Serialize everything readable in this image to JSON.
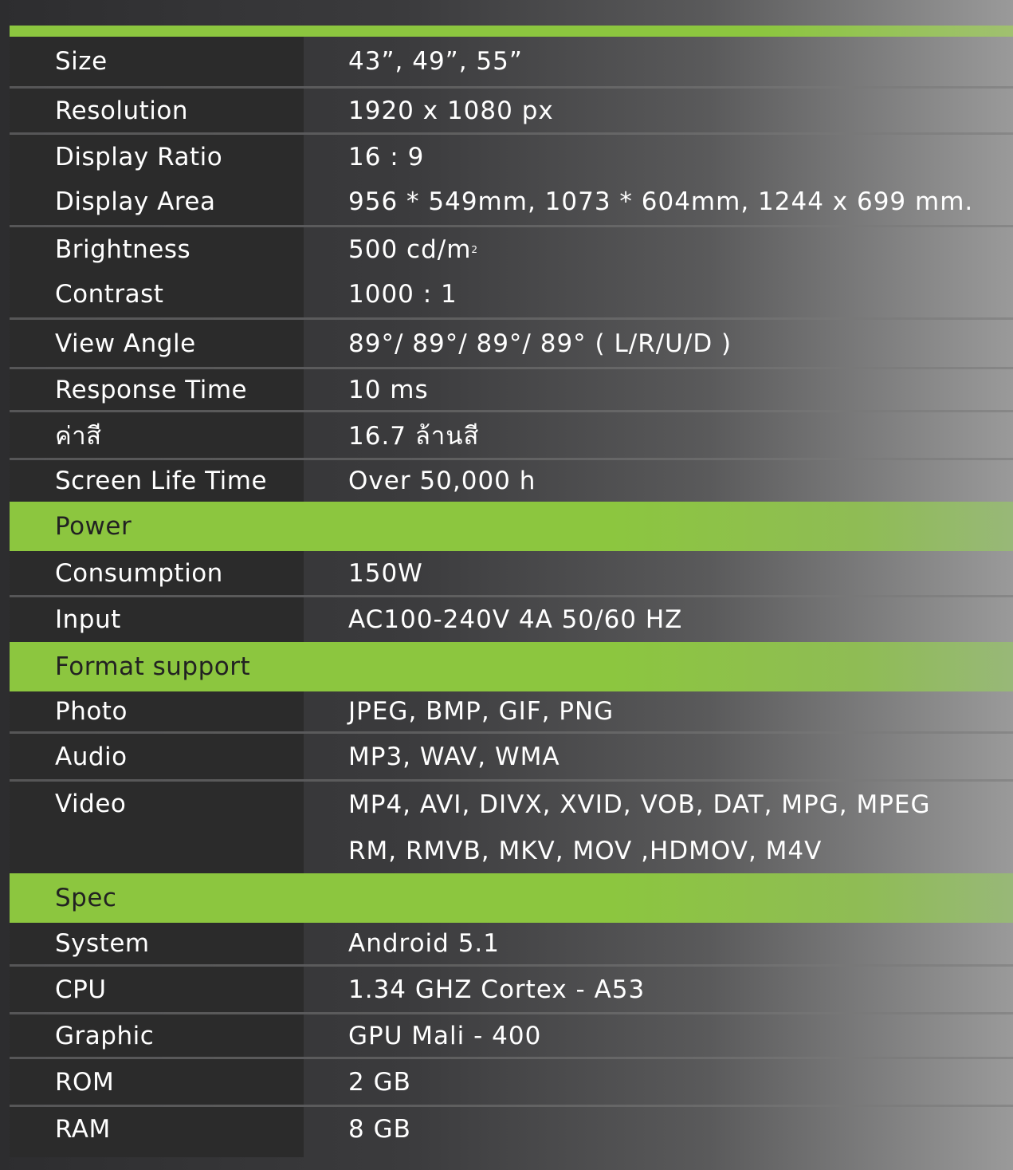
{
  "display": {
    "rows": [
      {
        "label": "Size",
        "value": "43”, 49”, 55”"
      },
      {
        "label": "Resolution",
        "value": "1920 x 1080 px"
      },
      {
        "label": "Display Ratio",
        "value": "16 : 9"
      },
      {
        "label": "Display Area",
        "value": "956 * 549mm, 1073 * 604mm, 1244 x 699 mm."
      },
      {
        "label": "Brightness",
        "value": "500 cd/m",
        "value_sup": "2"
      },
      {
        "label": "Contrast",
        "value": "1000 : 1"
      },
      {
        "label": "View Angle",
        "value": "89°/ 89°/ 89°/ 89° ( L/R/U/D )"
      },
      {
        "label": "Response Time",
        "value": "10 ms"
      },
      {
        "label": "ค่าสี",
        "value": "16.7 ล้านสี"
      },
      {
        "label": "Screen Life Time",
        "value": "Over 50,000 h"
      }
    ]
  },
  "power": {
    "title": "Power",
    "rows": [
      {
        "label": "Consumption",
        "value": "150W"
      },
      {
        "label": "Input",
        "value": "AC100-240V 4A 50/60 HZ"
      }
    ]
  },
  "format": {
    "title": "Format support",
    "rows": [
      {
        "label": "Photo",
        "value": "JPEG, BMP, GIF, PNG"
      },
      {
        "label": "Audio",
        "value": "MP3, WAV, WMA"
      },
      {
        "label": "Video",
        "value": "MP4, AVI, DIVX, XVID, VOB, DAT, MPG, MPEG",
        "value2": "RM, RMVB, MKV, MOV ,HDMOV, M4V"
      }
    ]
  },
  "spec": {
    "title": "Spec",
    "rows": [
      {
        "label": "System",
        "value": "Android 5.1"
      },
      {
        "label": "CPU",
        "value": "1.34 GHZ Cortex - A53"
      },
      {
        "label": "Graphic",
        "value": "GPU Mali - 400"
      },
      {
        "label": "ROM",
        "value": "2 GB"
      },
      {
        "label": "RAM",
        "value": "8 GB"
      }
    ]
  },
  "colors": {
    "accent": "#8cc63f",
    "label_bg": "#2b2b2b",
    "section_text": "#222222"
  }
}
